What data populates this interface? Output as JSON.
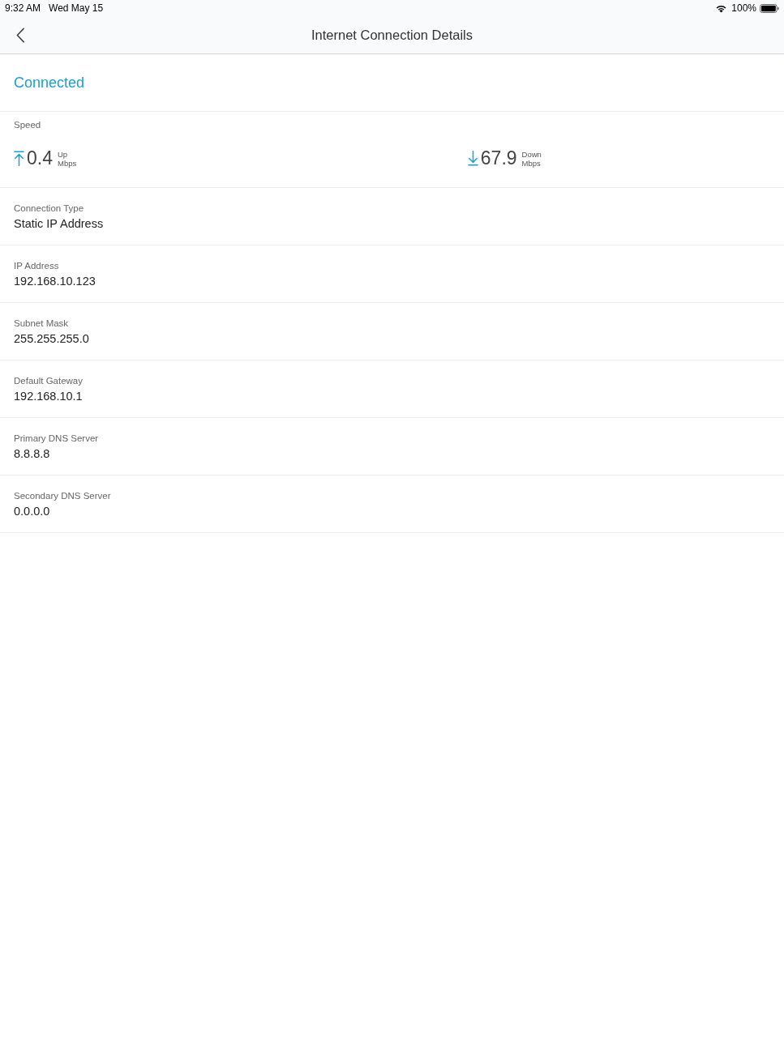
{
  "status_bar": {
    "time": "9:32 AM",
    "date": "Wed May 15",
    "battery": "100%"
  },
  "nav": {
    "title": "Internet Connection Details"
  },
  "connection_status": {
    "text": "Connected"
  },
  "speed": {
    "label": "Speed",
    "items": [
      {
        "kind": "up",
        "value": "0.4",
        "direction": "Up",
        "unit": "Mbps"
      },
      {
        "kind": "down",
        "value": "67.9",
        "direction": "Down",
        "unit": "Mbps"
      }
    ]
  },
  "details": [
    {
      "label": "Connection Type",
      "value": "Static IP Address"
    },
    {
      "label": "IP Address",
      "value": "192.168.10.123"
    },
    {
      "label": "Subnet Mask",
      "value": "255.255.255.0"
    },
    {
      "label": "Default Gateway",
      "value": "192.168.10.1"
    },
    {
      "label": "Primary DNS Server",
      "value": "8.8.8.8"
    },
    {
      "label": "Secondary DNS Server",
      "value": "0.0.0.0"
    }
  ]
}
